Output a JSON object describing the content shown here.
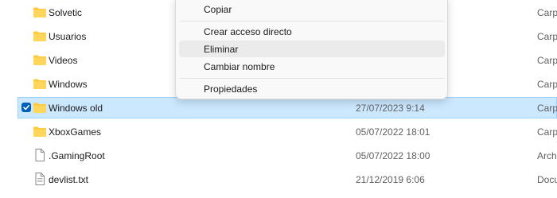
{
  "context_menu": {
    "items": [
      {
        "label": "Copiar"
      },
      {
        "label": "Crear acceso directo"
      },
      {
        "label": "Eliminar"
      },
      {
        "label": "Cambiar nombre"
      },
      {
        "label": "Propiedades"
      }
    ]
  },
  "files": [
    {
      "name": "Solvetic",
      "date": "",
      "type": "Carpe",
      "icon": "folder-icon",
      "selected": false
    },
    {
      "name": "Usuarios",
      "date": "",
      "type": "Carpe",
      "icon": "folder-icon",
      "selected": false
    },
    {
      "name": "Videos",
      "date": "",
      "type": "Carpe",
      "icon": "folder-icon",
      "selected": false
    },
    {
      "name": "Windows",
      "date": "",
      "type": "Carpe",
      "icon": "folder-icon",
      "selected": false
    },
    {
      "name": "Windows old",
      "date": "27/07/2023 9:14",
      "type": "Carpe",
      "icon": "folder-icon",
      "selected": true
    },
    {
      "name": "XboxGames",
      "date": "05/07/2022 18:01",
      "type": "Carpe",
      "icon": "folder-icon",
      "selected": false
    },
    {
      "name": ".GamingRoot",
      "date": "05/07/2022 18:00",
      "type": "Archi",
      "icon": "file-icon",
      "selected": false
    },
    {
      "name": "devlist.txt",
      "date": "21/12/2019 6:06",
      "type": "Docu",
      "icon": "text-file-icon",
      "selected": false
    }
  ],
  "colors": {
    "selection_bg": "#cce8ff",
    "selection_border": "#99d1ff",
    "folder_yellow": "#ffc83d",
    "menu_hover": "#ebebeb",
    "check_blue": "#005fb8"
  }
}
